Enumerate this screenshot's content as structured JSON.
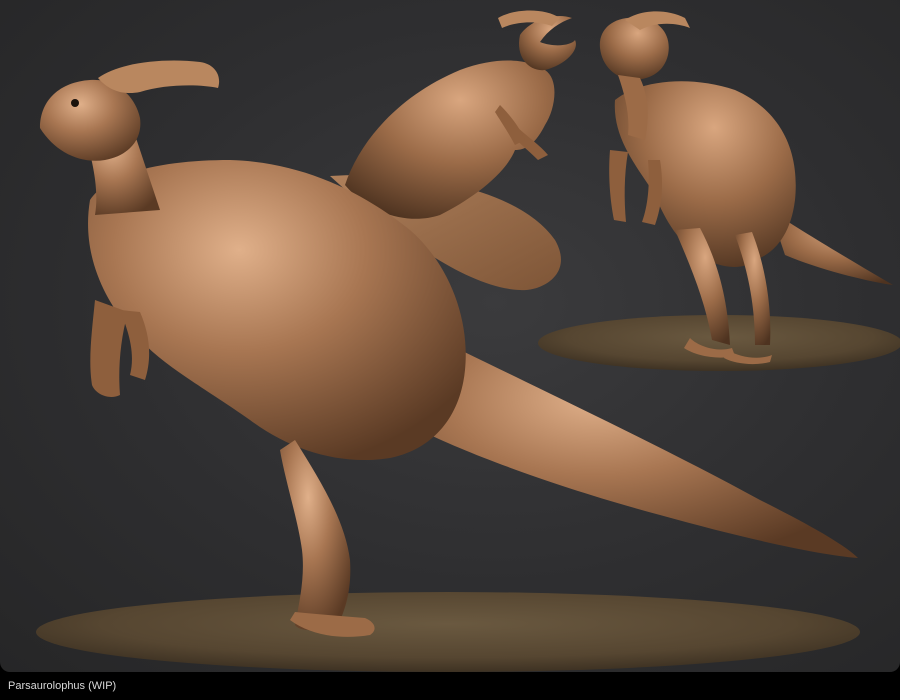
{
  "caption": "Parsaurolophus (WIP)",
  "colors": {
    "background": "#2f2f31",
    "frame": "#000000",
    "sculpt_clay": "#a0704c",
    "pedestal": "#5c4d39",
    "caption_text": "#d8d8d8"
  },
  "views": [
    {
      "name": "main-view"
    },
    {
      "name": "top-view"
    },
    {
      "name": "front-view"
    }
  ]
}
